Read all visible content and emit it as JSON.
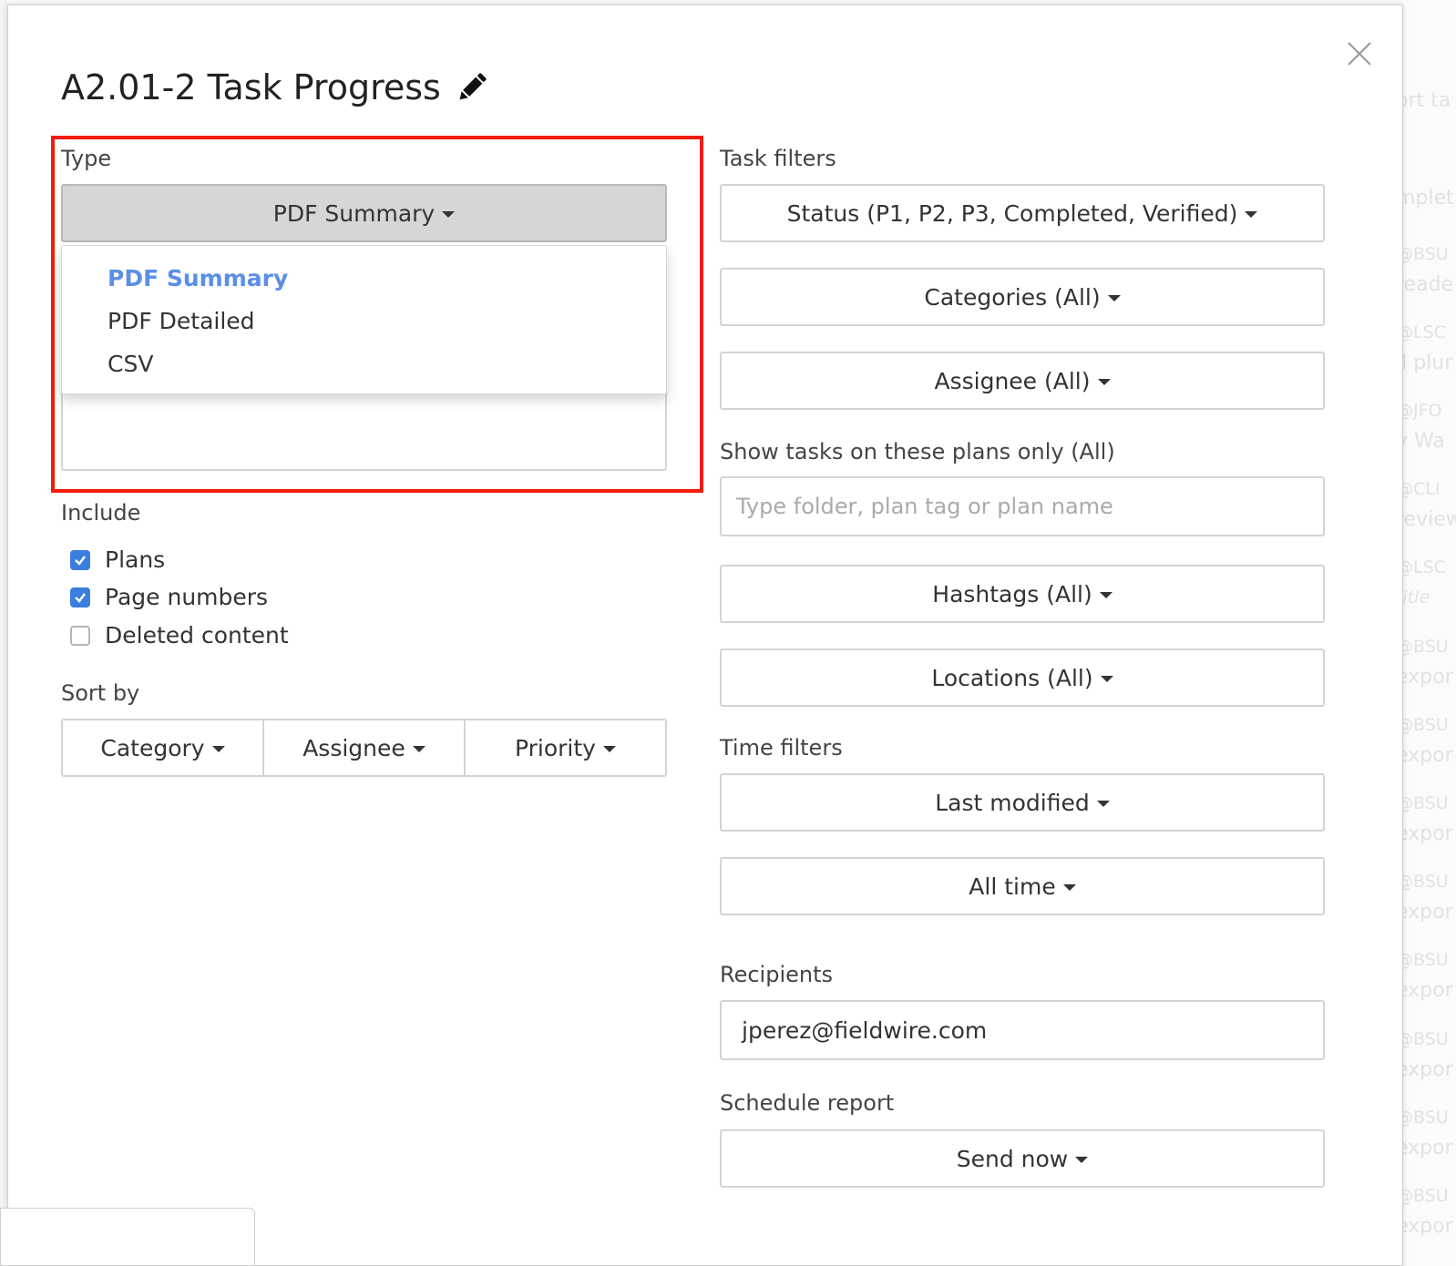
{
  "modal": {
    "title": "A2.01-2 Task Progress",
    "type": {
      "label": "Type",
      "selected": "PDF Summary",
      "options": [
        "PDF Summary",
        "PDF Detailed",
        "CSV"
      ]
    },
    "include": {
      "label": "Include",
      "items": [
        {
          "label": "Plans",
          "checked": true
        },
        {
          "label": "Page numbers",
          "checked": true
        },
        {
          "label": "Deleted content",
          "checked": false
        }
      ]
    },
    "sort": {
      "label": "Sort by",
      "options": [
        "Category",
        "Assignee",
        "Priority"
      ]
    },
    "task_filters": {
      "label": "Task filters",
      "status": "Status (P1, P2, P3, Completed, Verified)",
      "categories": "Categories (All)",
      "assignee": "Assignee (All)"
    },
    "plans_filter": {
      "label": "Show tasks on these plans only (All)",
      "placeholder": "Type folder, plan tag or plan name"
    },
    "hashtags": "Hashtags (All)",
    "locations": "Locations (All)",
    "time_filters": {
      "label": "Time filters",
      "field": "Last modified",
      "range": "All time"
    },
    "recipients": {
      "label": "Recipients",
      "value": "jperez@fieldwire.com"
    },
    "schedule": {
      "label": "Schedule report",
      "value": "Send now"
    }
  },
  "background": {
    "fragments": [
      "ort ta",
      "mplet",
      "@BSU",
      "reade",
      "@LSC",
      "ll plur",
      "@JFO",
      "y Wa",
      "@CLI",
      "review",
      "@LSC",
      "title",
      "@BSU",
      "expor",
      "@BSU",
      "expor",
      "@BSU",
      "expor",
      "@BSU",
      "expor",
      "@BSU",
      "expor",
      "@BSU",
      "expor",
      "@BSU",
      "expor",
      "@BSU",
      "expor"
    ]
  },
  "colors": {
    "highlight": "#f21c0a",
    "accent": "#5b8fe6",
    "checkbox": "#3c7de0"
  },
  "icons": [
    "pencil-icon",
    "close-icon",
    "caret-down-icon",
    "check-icon"
  ]
}
